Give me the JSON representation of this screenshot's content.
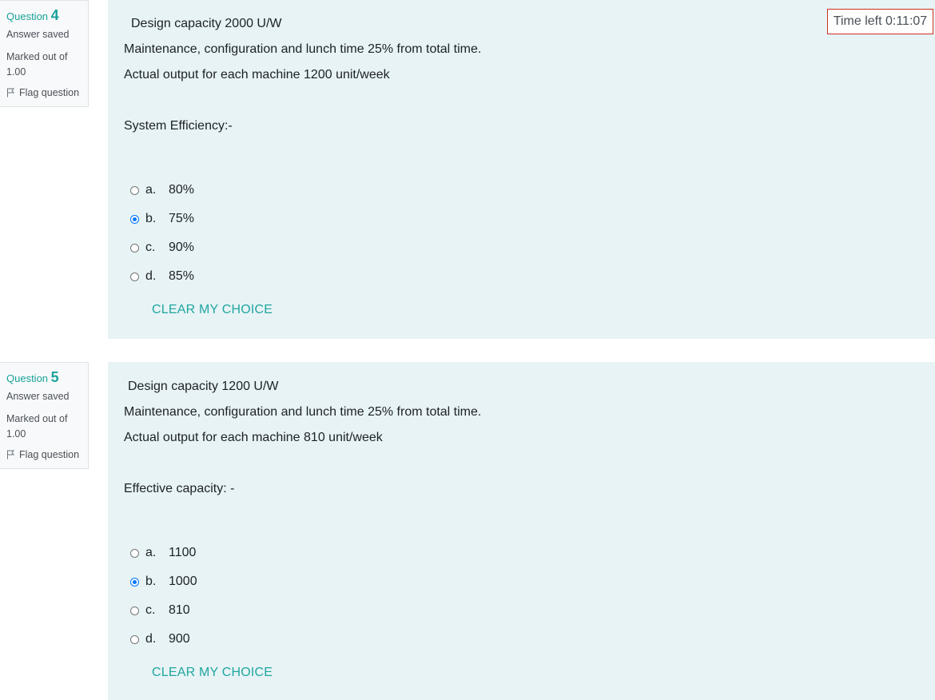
{
  "timer": {
    "label": "Time left 0:11:07"
  },
  "questions": [
    {
      "label": "Question",
      "number": "4",
      "state": "Answer saved",
      "grade_line1": "Marked out of",
      "grade_line2": "1.00",
      "flag_label": "Flag question",
      "lines": [
        "Design capacity 2000 U/W",
        "Maintenance, configuration and lunch time 25% from total time.",
        "Actual output for each machine 1200 unit/week",
        "System Efficiency:-"
      ],
      "options": [
        {
          "letter": "a.",
          "value": "80%",
          "checked": false
        },
        {
          "letter": "b.",
          "value": "75%",
          "checked": true
        },
        {
          "letter": "c.",
          "value": "90%",
          "checked": false
        },
        {
          "letter": "d.",
          "value": "85%",
          "checked": false
        }
      ],
      "clear_label": "CLEAR MY CHOICE"
    },
    {
      "label": "Question",
      "number": "5",
      "state": "Answer saved",
      "grade_line1": "Marked out of",
      "grade_line2": "1.00",
      "flag_label": "Flag question",
      "lines": [
        "Design capacity 1200 U/W",
        "Maintenance, configuration and lunch time 25% from total time.",
        "Actual output for each machine 810 unit/week",
        "Effective capacity: -"
      ],
      "options": [
        {
          "letter": "a.",
          "value": "1100",
          "checked": false
        },
        {
          "letter": "b.",
          "value": "1000",
          "checked": true
        },
        {
          "letter": "c.",
          "value": "810",
          "checked": false
        },
        {
          "letter": "d.",
          "value": "900",
          "checked": false
        }
      ],
      "clear_label": "CLEAR MY CHOICE"
    }
  ]
}
